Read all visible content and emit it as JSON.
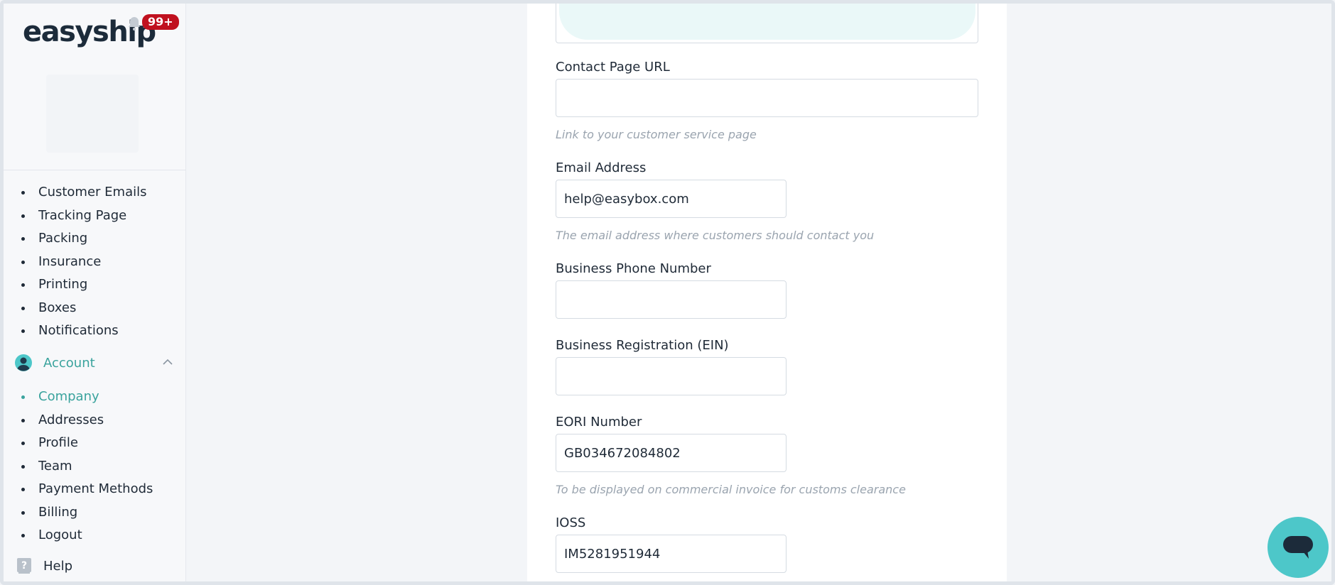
{
  "sidebar": {
    "logo_text": "easyship",
    "notification_badge": "99+",
    "nav_items_top": [
      "Customer Emails",
      "Tracking Page",
      "Packing",
      "Insurance",
      "Printing",
      "Boxes",
      "Notifications"
    ],
    "account_label": "Account",
    "account_items": [
      "Company",
      "Addresses",
      "Profile",
      "Team",
      "Payment Methods",
      "Billing",
      "Logout"
    ],
    "active_account_item": "Company",
    "help_label": "Help"
  },
  "form": {
    "contact_url": {
      "label": "Contact Page URL",
      "value": "",
      "hint": "Link to your customer service page"
    },
    "email": {
      "label": "Email Address",
      "value": "help@easybox.com",
      "hint": "The email address where customers should contact you"
    },
    "phone": {
      "label": "Business Phone Number",
      "value": ""
    },
    "registration": {
      "label": "Business Registration (EIN)",
      "value": ""
    },
    "eori": {
      "label": "EORI Number",
      "value": "GB034672084802",
      "hint": "To be displayed on commercial invoice for customs clearance"
    },
    "ioss": {
      "label": "IOSS",
      "value": "IM5281951944"
    }
  },
  "colors": {
    "accent": "#3aa39d",
    "badge": "#c0111f",
    "chat_button": "#4dc7c9",
    "brand_dark": "#1c2b3a"
  },
  "icons": [
    "bell-icon",
    "account-icon",
    "chevron-up-icon",
    "help-icon",
    "chat-icon"
  ]
}
